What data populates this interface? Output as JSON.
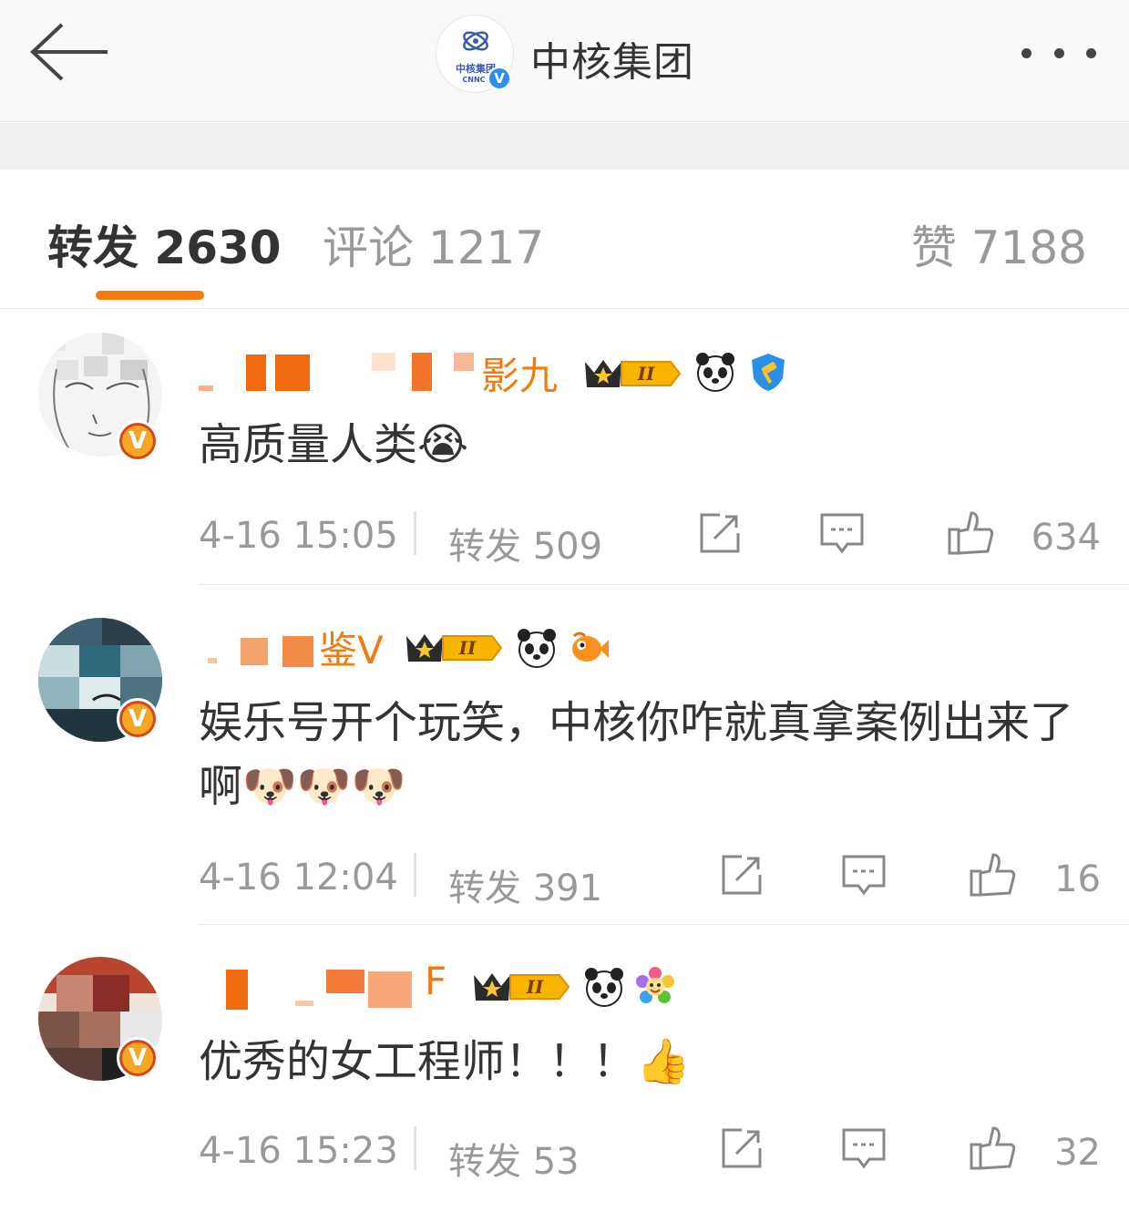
{
  "header": {
    "title": "中核集团",
    "logo_text": "中核集团",
    "logo_sub": "CNNC",
    "verified_mark": "V",
    "back_icon": "back-arrow-icon",
    "more_icon": "more-dots-icon"
  },
  "tabs": {
    "repost": "转发 2630",
    "comment": "评论 1217",
    "like": "赞 7188",
    "active": "repost",
    "accent_color": "#f77c0b"
  },
  "comments": [
    {
      "name_visible": "影九",
      "content": "高质量人类😭",
      "time": "4-16 15:05",
      "repost": "转发 509",
      "likes": "634",
      "badge": "V"
    },
    {
      "name_visible": "鉴V",
      "content": "娱乐号开个玩笑，中核你咋就真拿案例出来了啊🐶🐶🐶",
      "time": "4-16 12:04",
      "repost": "转发 391",
      "likes": "16",
      "badge": "V"
    },
    {
      "name_visible": "F",
      "content": "优秀的女工程师！！！👍",
      "time": "4-16 15:23",
      "repost": "转发 53",
      "likes": "32",
      "badge": "V"
    }
  ],
  "icons": {
    "share": "share-icon",
    "comment": "comment-icon",
    "like": "thumbs-up-icon",
    "crown_level": "II"
  }
}
